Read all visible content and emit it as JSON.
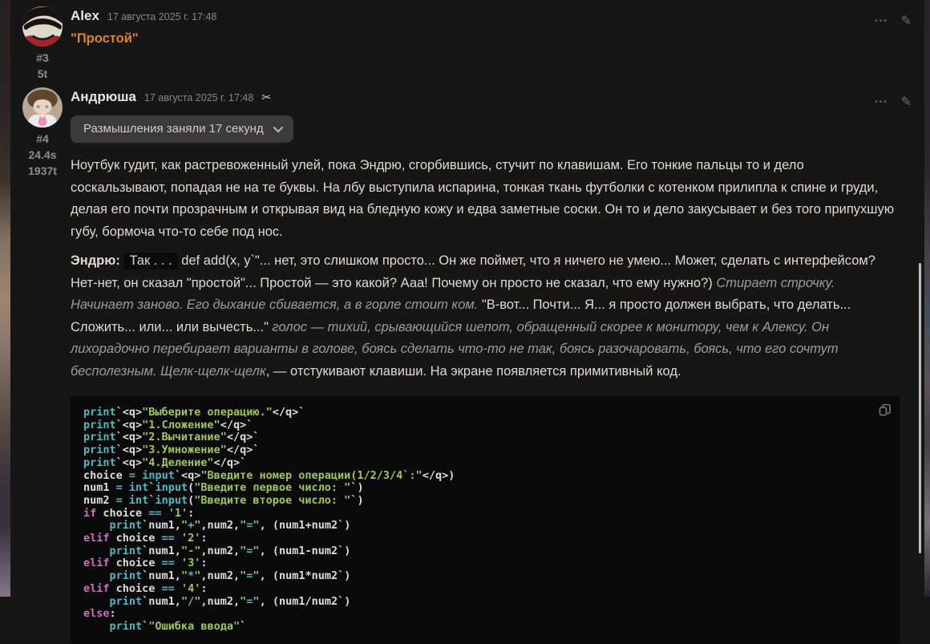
{
  "icons": {
    "options_glyph": "•••",
    "edit_glyph": "✎",
    "scissors_glyph": "✂"
  },
  "messages": [
    {
      "author": "Alex",
      "timestamp": "17 августа 2025 г. 17:48",
      "message_number": "#3",
      "token_count": "5t",
      "text": "\"Простой\""
    },
    {
      "author": "Андрюша",
      "timestamp": "17 августа 2025 г. 17:48",
      "message_number": "#4",
      "generation_time": "24.4s",
      "token_count": "1937t",
      "reasoning_toggle_label": "Размышления заняли 17 секунд",
      "paragraph_1": "Ноутбук гудит, как растревоженный улей, пока Эндрю, сгорбившись, стучит по клавишам. Его тонкие пальцы то и дело соскальзывают, попадая не на те буквы. На лбу выступила испарина, тонкая ткань футболки с котенком прилипла к спине и груди, делая его почти прозрачным и открывая вид на бледную кожу и едва заметные соски. Он то и дело закусывает и без того припухшую губу, бормоча что-то себе под нос.",
      "paragraph_2_segments": [
        {
          "style": "bold",
          "text": "Эндрю: "
        },
        {
          "style": "chip",
          "text": "Так . . ."
        },
        {
          "style": "normal",
          "text": " def add(x, y`\"... нет, это слишком просто... Он же поймет, что я ничего не умею... Может, сделать с интерфейсом? Нет-нет, он сказал \"простой\"... Простой — это какой? Ааа! Почему он просто не сказал, что ему нужно?) "
        },
        {
          "style": "italic",
          "text": "Стирает строчку. Начинает заново. Его дыхание сбивается, а в горле стоит ком."
        },
        {
          "style": "normal",
          "text": " \"В-вот... Почти... Я... я просто должен выбрать, что делать... Сложить... или... или вычесть...\" "
        },
        {
          "style": "italic",
          "text": "голос — тихий, срывающийся шепот, обращенный скорее к монитору, чем к Алексу. Он лихорадочно перебирает варианты в голове, боясь сделать что-то не так, боясь разочаровать, боясь, что его сочтут бесполезным. Щелк-щелк-щелк"
        },
        {
          "style": "normal",
          "text": ", — отстукивают клавиши. На экране появляется примитивный код."
        }
      ]
    }
  ],
  "code": {
    "lines": [
      [
        {
          "c": "fn",
          "t": "print"
        },
        {
          "c": "pl",
          "t": "`<q>"
        },
        {
          "c": "str",
          "t": "\"Выберите операцию.\""
        },
        {
          "c": "pl",
          "t": "</q>`"
        }
      ],
      [
        {
          "c": "fn",
          "t": "print"
        },
        {
          "c": "pl",
          "t": "`<q>"
        },
        {
          "c": "str",
          "t": "\"1.Сложение\""
        },
        {
          "c": "pl",
          "t": "</q>`"
        }
      ],
      [
        {
          "c": "fn",
          "t": "print"
        },
        {
          "c": "pl",
          "t": "`<q>"
        },
        {
          "c": "str",
          "t": "\"2.Вычитание\""
        },
        {
          "c": "pl",
          "t": "</q>`"
        }
      ],
      [
        {
          "c": "fn",
          "t": "print"
        },
        {
          "c": "pl",
          "t": "`<q>"
        },
        {
          "c": "str",
          "t": "\"3.Умножение\""
        },
        {
          "c": "pl",
          "t": "</q>`"
        }
      ],
      [
        {
          "c": "fn",
          "t": "print"
        },
        {
          "c": "pl",
          "t": "`<q>"
        },
        {
          "c": "str",
          "t": "\"4.Деление\""
        },
        {
          "c": "pl",
          "t": "</q>`"
        }
      ],
      [
        {
          "c": "pl",
          "t": "choice "
        },
        {
          "c": "op",
          "t": "="
        },
        {
          "c": "pl",
          "t": " "
        },
        {
          "c": "fn",
          "t": "input"
        },
        {
          "c": "pl",
          "t": "`<q>"
        },
        {
          "c": "str",
          "t": "\"Введите номер операции(1/2/3/4`:\""
        },
        {
          "c": "pl",
          "t": "</q>)"
        }
      ],
      [
        {
          "c": "pl",
          "t": "num1 "
        },
        {
          "c": "op",
          "t": "="
        },
        {
          "c": "pl",
          "t": " "
        },
        {
          "c": "fn",
          "t": "int"
        },
        {
          "c": "pl",
          "t": "`"
        },
        {
          "c": "fn",
          "t": "input"
        },
        {
          "c": "pl",
          "t": "("
        },
        {
          "c": "str",
          "t": "\"Введите первое число: \""
        },
        {
          "c": "pl",
          "t": "`)"
        }
      ],
      [
        {
          "c": "pl",
          "t": "num2 "
        },
        {
          "c": "op",
          "t": "="
        },
        {
          "c": "pl",
          "t": " "
        },
        {
          "c": "fn",
          "t": "int"
        },
        {
          "c": "pl",
          "t": "`"
        },
        {
          "c": "fn",
          "t": "input"
        },
        {
          "c": "pl",
          "t": "("
        },
        {
          "c": "str",
          "t": "\"Введите второе число: \""
        },
        {
          "c": "pl",
          "t": "`)"
        }
      ],
      [
        {
          "c": "kw",
          "t": "if"
        },
        {
          "c": "pl",
          "t": " choice "
        },
        {
          "c": "op",
          "t": "=="
        },
        {
          "c": "pl",
          "t": " "
        },
        {
          "c": "str",
          "t": "'1'"
        },
        {
          "c": "pl",
          "t": ":"
        }
      ],
      [
        {
          "c": "pl",
          "t": "    "
        },
        {
          "c": "fn",
          "t": "print"
        },
        {
          "c": "pl",
          "t": "`num1,"
        },
        {
          "c": "str",
          "t": "\""
        },
        {
          "c": "op",
          "t": "+"
        },
        {
          "c": "str",
          "t": "\""
        },
        {
          "c": "pl",
          "t": ",num2,"
        },
        {
          "c": "str",
          "t": "\""
        },
        {
          "c": "op",
          "t": "="
        },
        {
          "c": "str",
          "t": "\""
        },
        {
          "c": "pl",
          "t": ", (num1+num2`)"
        }
      ],
      [
        {
          "c": "kw",
          "t": "elif"
        },
        {
          "c": "pl",
          "t": " choice "
        },
        {
          "c": "op",
          "t": "=="
        },
        {
          "c": "pl",
          "t": " "
        },
        {
          "c": "str",
          "t": "'2'"
        },
        {
          "c": "pl",
          "t": ":"
        }
      ],
      [
        {
          "c": "pl",
          "t": "    "
        },
        {
          "c": "fn",
          "t": "print"
        },
        {
          "c": "pl",
          "t": "`num1,"
        },
        {
          "c": "str",
          "t": "\""
        },
        {
          "c": "op",
          "t": "-"
        },
        {
          "c": "str",
          "t": "\""
        },
        {
          "c": "pl",
          "t": ",num2,"
        },
        {
          "c": "str",
          "t": "\""
        },
        {
          "c": "op",
          "t": "="
        },
        {
          "c": "str",
          "t": "\""
        },
        {
          "c": "pl",
          "t": ", (num1-num2`)"
        }
      ],
      [
        {
          "c": "kw",
          "t": "elif"
        },
        {
          "c": "pl",
          "t": " choice "
        },
        {
          "c": "op",
          "t": "=="
        },
        {
          "c": "pl",
          "t": " "
        },
        {
          "c": "str",
          "t": "'3'"
        },
        {
          "c": "pl",
          "t": ":"
        }
      ],
      [
        {
          "c": "pl",
          "t": "    "
        },
        {
          "c": "fn",
          "t": "print"
        },
        {
          "c": "pl",
          "t": "`num1,"
        },
        {
          "c": "str",
          "t": "\""
        },
        {
          "c": "op",
          "t": "*"
        },
        {
          "c": "str",
          "t": "\""
        },
        {
          "c": "pl",
          "t": ",num2,"
        },
        {
          "c": "str",
          "t": "\""
        },
        {
          "c": "op",
          "t": "="
        },
        {
          "c": "str",
          "t": "\""
        },
        {
          "c": "pl",
          "t": ", (num1*num2`)"
        }
      ],
      [
        {
          "c": "kw",
          "t": "elif"
        },
        {
          "c": "pl",
          "t": " choice "
        },
        {
          "c": "op",
          "t": "=="
        },
        {
          "c": "pl",
          "t": " "
        },
        {
          "c": "str",
          "t": "'4'"
        },
        {
          "c": "pl",
          "t": ":"
        }
      ],
      [
        {
          "c": "pl",
          "t": "    "
        },
        {
          "c": "fn",
          "t": "print"
        },
        {
          "c": "pl",
          "t": "`num1,"
        },
        {
          "c": "str",
          "t": "\""
        },
        {
          "c": "op",
          "t": "/"
        },
        {
          "c": "str",
          "t": "\""
        },
        {
          "c": "pl",
          "t": ",num2,"
        },
        {
          "c": "str",
          "t": "\""
        },
        {
          "c": "op",
          "t": "="
        },
        {
          "c": "str",
          "t": "\""
        },
        {
          "c": "pl",
          "t": ", (num1/num2`)"
        }
      ],
      [
        {
          "c": "kw",
          "t": "else"
        },
        {
          "c": "pl",
          "t": ":"
        }
      ],
      [
        {
          "c": "pl",
          "t": "    "
        },
        {
          "c": "fn",
          "t": "print"
        },
        {
          "c": "pl",
          "t": "`"
        },
        {
          "c": "str",
          "t": "\"Ошибка ввода\""
        },
        {
          "c": "pl",
          "t": "`"
        }
      ]
    ]
  }
}
